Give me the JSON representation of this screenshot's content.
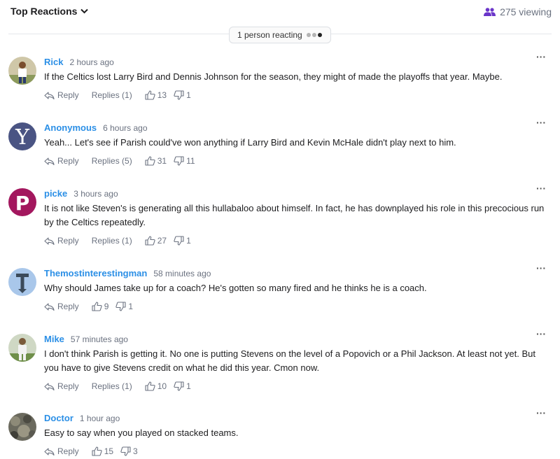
{
  "header": {
    "sort_label": "Top Reactions",
    "viewing_text": "275 viewing",
    "reacting_text": "1 person reacting"
  },
  "colors": {
    "accent": "#2b8fe6",
    "viewers_icon": "#6a35c9"
  },
  "comments": [
    {
      "name": "Rick",
      "time": "2 hours ago",
      "text": "If the Celtics lost Larry Bird and Dennis Johnson for the season, they might of made the playoffs that year. Maybe.",
      "reply": "Reply",
      "replies": "Replies (1)",
      "likes": "13",
      "dislikes": "1"
    },
    {
      "name": "Anonymous",
      "time": "6 hours ago",
      "text": "Yeah... Let's see if Parish could've won anything if Larry Bird and Kevin McHale didn't play next to him.",
      "reply": "Reply",
      "replies": "Replies (5)",
      "likes": "31",
      "dislikes": "11"
    },
    {
      "name": "picke",
      "time": "3 hours ago",
      "text": "It is not like Steven's is generating all this hullabaloo about himself. In fact, he has downplayed his role in this precocious run by the Celtics repeatedly.",
      "reply": "Reply",
      "replies": "Replies (1)",
      "likes": "27",
      "dislikes": "1"
    },
    {
      "name": "Themostinterestingman",
      "time": "58 minutes ago",
      "text": "Why should James take up for a coach? He's gotten so many fired and he thinks he is a coach.",
      "reply": "Reply",
      "likes": "9",
      "dislikes": "1"
    },
    {
      "name": "Mike",
      "time": "57 minutes ago",
      "text": "I don't think Parish is getting it. No one is putting Stevens on the level of a Popovich or a Phil Jackson. At least not yet. But you have to give Stevens credit on what he did this year. Cmon now.",
      "reply": "Reply",
      "replies": "Replies (1)",
      "likes": "10",
      "dislikes": "1"
    },
    {
      "name": "Doctor",
      "time": "1 hour ago",
      "text": "Easy to say when you played on stacked teams.",
      "reply": "Reply",
      "likes": "15",
      "dislikes": "3"
    }
  ]
}
